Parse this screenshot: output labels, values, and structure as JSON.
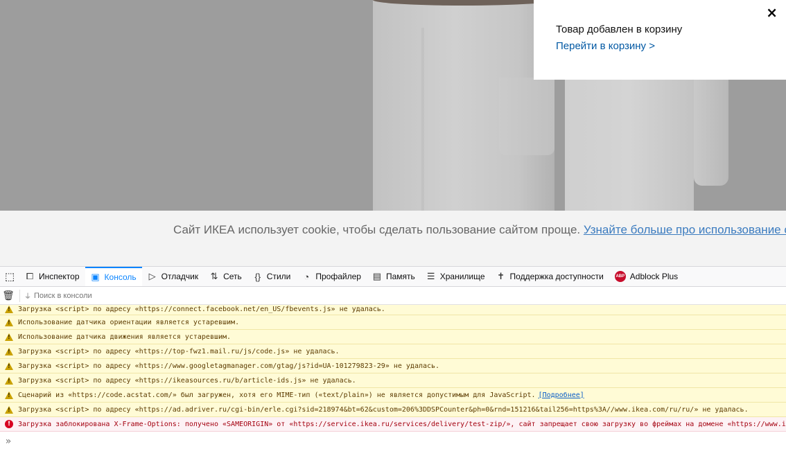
{
  "cart_toast": {
    "close": "×",
    "title": "Товар добавлен в корзину",
    "link": "Перейти в корзину >"
  },
  "cookie_bar": {
    "text": "Сайт ИКЕА использует cookie, чтобы сделать пользование сайтом проще.",
    "more_link": "Узнайте больше про использование cookie"
  },
  "devtools": {
    "tabs": [
      {
        "label": "Инспектор",
        "icon": "inspector-icon"
      },
      {
        "label": "Консоль",
        "icon": "console-icon"
      },
      {
        "label": "Отладчик",
        "icon": "debugger-icon"
      },
      {
        "label": "Сеть",
        "icon": "network-icon"
      },
      {
        "label": "Стили",
        "icon": "style-editor-icon"
      },
      {
        "label": "Профайлер",
        "icon": "profiler-icon"
      },
      {
        "label": "Память",
        "icon": "memory-icon"
      },
      {
        "label": "Хранилище",
        "icon": "storage-icon"
      },
      {
        "label": "Поддержка доступности",
        "icon": "accessibility-icon"
      },
      {
        "label": "Adblock Plus",
        "icon": "adblock-plus-icon",
        "badge": "ABP"
      }
    ],
    "active_tab": "Консоль",
    "filter_placeholder": "Поиск в консоли",
    "messages": [
      {
        "level": "warn",
        "text": "Загрузка <script> по адресу «https://connect.facebook.net/en_US/fbevents.js» не удалась."
      },
      {
        "level": "warn",
        "text": "Использование датчика ориентации является устаревшим."
      },
      {
        "level": "warn",
        "text": "Использование датчика движения является устаревшим."
      },
      {
        "level": "warn",
        "text": "Загрузка <script> по адресу «https://top-fwz1.mail.ru/js/code.js» не удалась."
      },
      {
        "level": "warn",
        "text": "Загрузка <script> по адресу «https://www.googletagmanager.com/gtag/js?id=UA-101279823-29» не удалась."
      },
      {
        "level": "warn",
        "text": "Загрузка <script> по адресу «https://ikeasources.ru/b/article-ids.js» не удалась."
      },
      {
        "level": "warn",
        "text": "Сценарий из «https://code.acstat.com/» был загружен, хотя его MIME-тип («text/plain») не является допустимым для JavaScript.",
        "learn_more": "[Подробнее]"
      },
      {
        "level": "warn",
        "text": "Загрузка <script> по адресу «https://ad.adriver.ru/cgi-bin/erle.cgi?sid=218974&bt=62&custom=206%3DDSPCounter&ph=0&rnd=151216&tail256=https%3A//www.ikea.com/ru/ru/» не удалась."
      },
      {
        "level": "error",
        "text": "Загрузка заблокирована X-Frame-Options: получено «SAMEORIGIN» от «https://service.ikea.ru/services/delivery/test-zip/», сайт запрещает свою загрузку во фреймах на домене «https://www.ikea.com»."
      }
    ],
    "prompt": "»"
  },
  "colors": {
    "accent": "#0a84ff",
    "warning_bg": "#fffbd6",
    "error_bg": "#fdf2f5",
    "ikea_link": "#0058a3"
  }
}
